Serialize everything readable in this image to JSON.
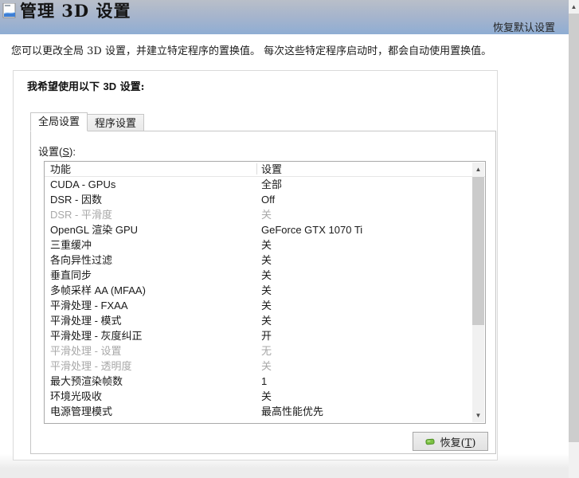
{
  "header": {
    "title": "管理 3D 设置",
    "restore_defaults": "恢复默认设置"
  },
  "intro": "您可以更改全局 3D 设置，并建立特定程序的置换值。 每次这些特定程序启动时，都会自动使用置换值。",
  "panel": {
    "heading": {
      "prefix": "我希望使用以下 ",
      "bold": "3D",
      "suffix": " 设置:"
    },
    "tabs": [
      {
        "label": "全局设置",
        "active": true
      },
      {
        "label": "程序设置",
        "active": false
      }
    ],
    "settings_label": {
      "pre": "设置(",
      "key": "S",
      "post": "):"
    }
  },
  "table": {
    "columns": {
      "feature": "功能",
      "value": "设置"
    },
    "rows": [
      {
        "feature": "CUDA - GPUs",
        "value": "全部",
        "disabled": false
      },
      {
        "feature": "DSR - 因数",
        "value": "Off",
        "disabled": false
      },
      {
        "feature": "DSR - 平滑度",
        "value": "关",
        "disabled": true
      },
      {
        "feature": "OpenGL 渲染 GPU",
        "value": "GeForce GTX 1070 Ti",
        "disabled": false
      },
      {
        "feature": "三重缓冲",
        "value": "关",
        "disabled": false
      },
      {
        "feature": "各向异性过滤",
        "value": "关",
        "disabled": false
      },
      {
        "feature": "垂直同步",
        "value": "关",
        "disabled": false
      },
      {
        "feature": "多帧采样 AA (MFAA)",
        "value": "关",
        "disabled": false
      },
      {
        "feature": "平滑处理 - FXAA",
        "value": "关",
        "disabled": false
      },
      {
        "feature": "平滑处理 - 模式",
        "value": "关",
        "disabled": false
      },
      {
        "feature": "平滑处理 - 灰度纠正",
        "value": "开",
        "disabled": false
      },
      {
        "feature": "平滑处理 - 设置",
        "value": "无",
        "disabled": true
      },
      {
        "feature": "平滑处理 - 透明度",
        "value": "关",
        "disabled": true
      },
      {
        "feature": "最大预渲染帧数",
        "value": "1",
        "disabled": false
      },
      {
        "feature": "环境光吸收",
        "value": "关",
        "disabled": false
      },
      {
        "feature": "电源管理模式",
        "value": "最高性能优先",
        "disabled": false
      }
    ]
  },
  "restore_button": {
    "pre": "恢复(",
    "key": "T",
    "post": ")"
  },
  "scrollbar": {
    "up_glyph": "▲",
    "down_glyph": "▼"
  },
  "colors": {
    "band_top": "#b9bfc9",
    "band_bottom": "#8fadd3",
    "disabled_text": "#a8a8a8",
    "normal_text": "#1a1a1a",
    "listbox_border": "#a9a9a9",
    "scrollbar_thumb": "#cdcdcd",
    "button_icon_green": "#7cc143"
  }
}
